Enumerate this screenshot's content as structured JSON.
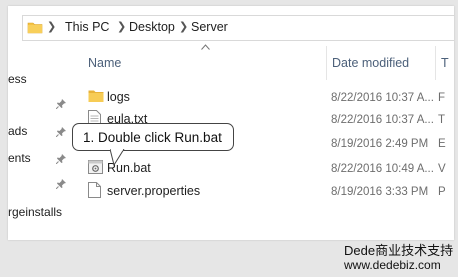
{
  "breadcrumb": [
    "This PC",
    "Desktop",
    "Server"
  ],
  "columns": {
    "name": "Name",
    "date_modified": "Date modified",
    "type_partial": "T"
  },
  "nav_items": [
    "ess",
    "ads",
    "ents",
    "rgeinstalls"
  ],
  "files": [
    {
      "name": "logs",
      "date": "8/22/2016 10:37 A...",
      "type": "F",
      "icon": "folder-icon"
    },
    {
      "name": "eula.txt",
      "date": "8/22/2016 10:37 A...",
      "type": "T",
      "icon": "text-file-icon"
    },
    {
      "name": "",
      "date": "8/19/2016 2:49 PM",
      "type": "E",
      "icon": "jar-file-icon"
    },
    {
      "name": "Run.bat",
      "date": "8/22/2016 10:49 A...",
      "type": "V",
      "icon": "batch-file-icon"
    },
    {
      "name": "server.properties",
      "date": "8/19/2016 3:33 PM",
      "type": "P",
      "icon": "file-icon"
    }
  ],
  "callout": {
    "text": "1. Double click Run.bat"
  },
  "watermark": {
    "line1": "Dede商业技术支持",
    "line2": "www.dedebiz.com"
  },
  "colors": {
    "folder": "#f5c242",
    "header_text": "#4c607a",
    "date_text": "#6d6d6d"
  }
}
